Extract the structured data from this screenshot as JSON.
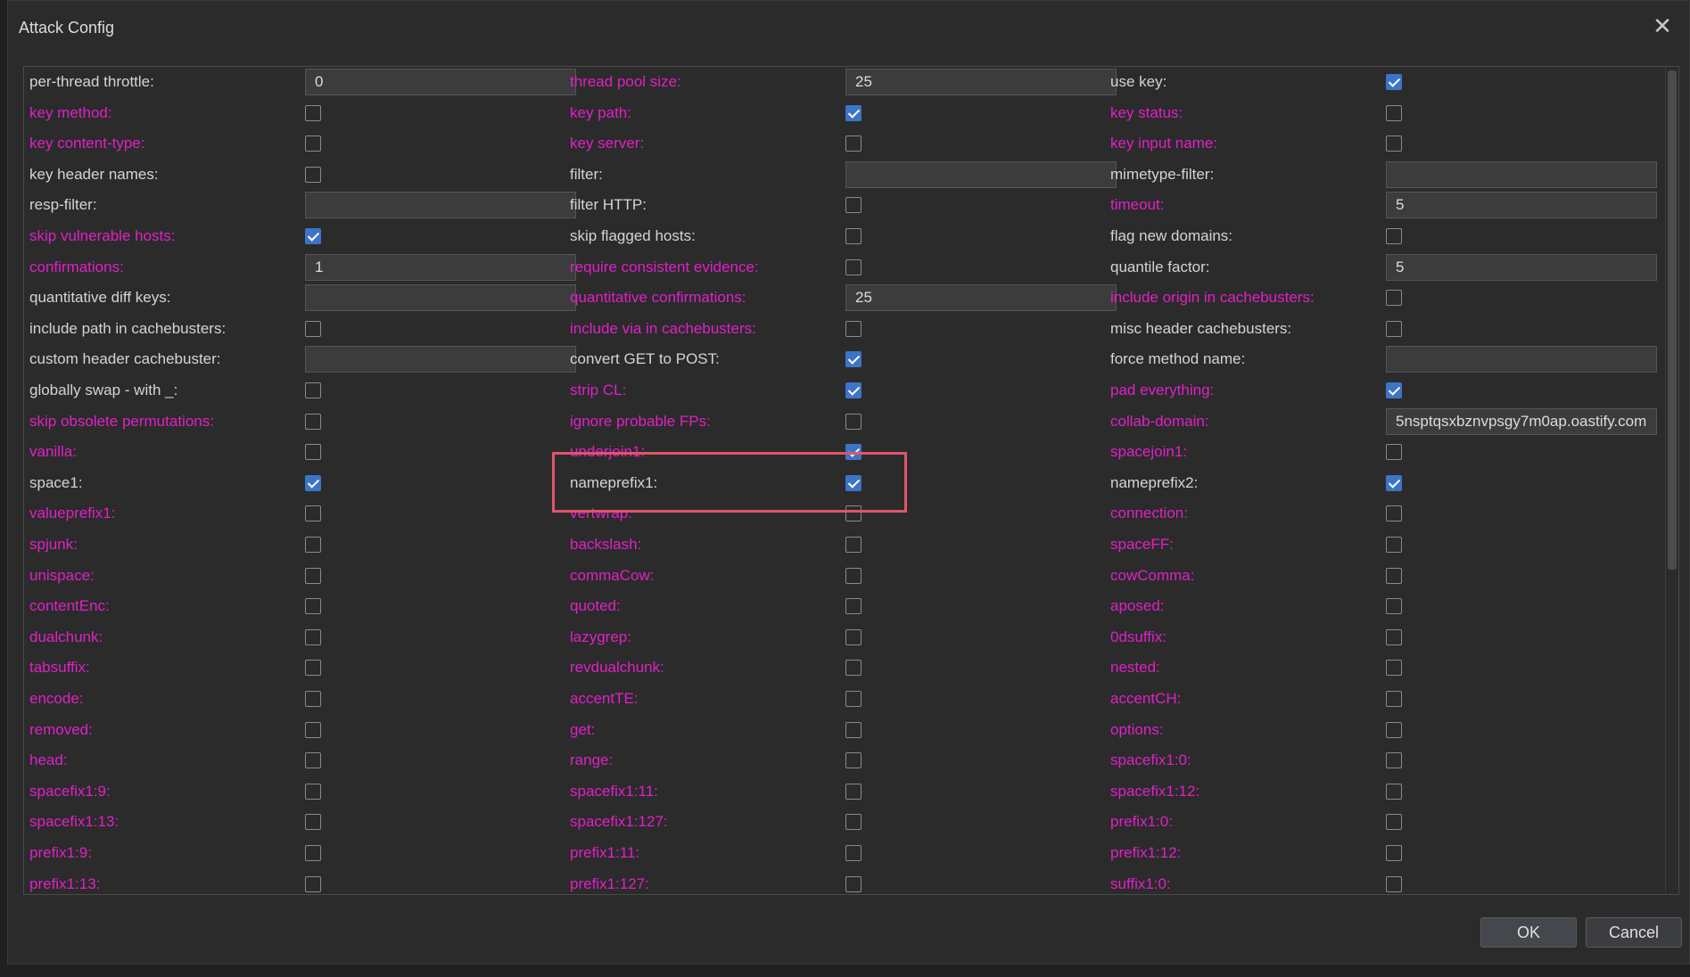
{
  "dialog": {
    "title": "Attack Config",
    "close_label": "✕",
    "ok_label": "OK",
    "cancel_label": "Cancel"
  },
  "colors": {
    "normal_label": "#d4d4d4",
    "special_label": "#e020c8",
    "checkbox_checked": "#3c74c8",
    "highlight": "#e0556a"
  },
  "rows": [
    [
      {
        "label": "per-thread throttle:",
        "special": false,
        "type": "text",
        "value": "0"
      },
      {
        "label": "thread pool size:",
        "special": true,
        "type": "text",
        "value": "25"
      },
      {
        "label": "use key:",
        "special": false,
        "type": "check",
        "checked": true
      }
    ],
    [
      {
        "label": "key method:",
        "special": true,
        "type": "check",
        "checked": false
      },
      {
        "label": "key path:",
        "special": true,
        "type": "check",
        "checked": true
      },
      {
        "label": "key status:",
        "special": true,
        "type": "check",
        "checked": false
      }
    ],
    [
      {
        "label": "key content-type:",
        "special": true,
        "type": "check",
        "checked": false
      },
      {
        "label": "key server:",
        "special": true,
        "type": "check",
        "checked": false
      },
      {
        "label": "key input name:",
        "special": true,
        "type": "check",
        "checked": false
      }
    ],
    [
      {
        "label": "key header names:",
        "special": false,
        "type": "check",
        "checked": false
      },
      {
        "label": "filter:",
        "special": false,
        "type": "text",
        "value": ""
      },
      {
        "label": "mimetype-filter:",
        "special": false,
        "type": "text",
        "value": ""
      }
    ],
    [
      {
        "label": "resp-filter:",
        "special": false,
        "type": "text",
        "value": ""
      },
      {
        "label": "filter HTTP:",
        "special": false,
        "type": "check",
        "checked": false
      },
      {
        "label": "timeout:",
        "special": true,
        "type": "text",
        "value": "5"
      }
    ],
    [
      {
        "label": "skip vulnerable hosts:",
        "special": true,
        "type": "check",
        "checked": true
      },
      {
        "label": "skip flagged hosts:",
        "special": false,
        "type": "check",
        "checked": false
      },
      {
        "label": "flag new domains:",
        "special": false,
        "type": "check",
        "checked": false
      }
    ],
    [
      {
        "label": "confirmations:",
        "special": true,
        "type": "text",
        "value": "1"
      },
      {
        "label": "require consistent evidence:",
        "special": true,
        "type": "check",
        "checked": false
      },
      {
        "label": "quantile factor:",
        "special": false,
        "type": "text",
        "value": "5"
      }
    ],
    [
      {
        "label": "quantitative diff keys:",
        "special": false,
        "type": "text",
        "value": ""
      },
      {
        "label": "quantitative confirmations:",
        "special": true,
        "type": "text",
        "value": "25"
      },
      {
        "label": "include origin in cachebusters:",
        "special": true,
        "type": "check",
        "checked": false
      }
    ],
    [
      {
        "label": "include path in cachebusters:",
        "special": false,
        "type": "check",
        "checked": false
      },
      {
        "label": "include via in cachebusters:",
        "special": true,
        "type": "check",
        "checked": false
      },
      {
        "label": "misc header cachebusters:",
        "special": false,
        "type": "check",
        "checked": false
      }
    ],
    [
      {
        "label": "custom header cachebuster:",
        "special": false,
        "type": "text",
        "value": ""
      },
      {
        "label": "convert GET to POST:",
        "special": false,
        "type": "check",
        "checked": true
      },
      {
        "label": "force method name:",
        "special": false,
        "type": "text",
        "value": ""
      }
    ],
    [
      {
        "label": "globally swap - with _:",
        "special": false,
        "type": "check",
        "checked": false
      },
      {
        "label": "strip CL:",
        "special": true,
        "type": "check",
        "checked": true
      },
      {
        "label": "pad everything:",
        "special": true,
        "type": "check",
        "checked": true
      }
    ],
    [
      {
        "label": "skip obsolete permutations:",
        "special": true,
        "type": "check",
        "checked": false
      },
      {
        "label": "ignore probable FPs:",
        "special": true,
        "type": "check",
        "checked": false
      },
      {
        "label": "collab-domain:",
        "special": true,
        "type": "text",
        "value": "5nsptqsxbznvpsgy7m0ap.oastify.com"
      }
    ],
    [
      {
        "label": "vanilla:",
        "special": true,
        "type": "check",
        "checked": false
      },
      {
        "label": "underjoin1:",
        "special": true,
        "type": "check",
        "checked": true
      },
      {
        "label": "spacejoin1:",
        "special": true,
        "type": "check",
        "checked": false
      }
    ],
    [
      {
        "label": "space1:",
        "special": false,
        "type": "check",
        "checked": true
      },
      {
        "label": "nameprefix1:",
        "special": false,
        "type": "check",
        "checked": true
      },
      {
        "label": "nameprefix2:",
        "special": false,
        "type": "check",
        "checked": true
      }
    ],
    [
      {
        "label": "valueprefix1:",
        "special": true,
        "type": "check",
        "checked": false
      },
      {
        "label": "vertwrap:",
        "special": true,
        "type": "check",
        "checked": false
      },
      {
        "label": "connection:",
        "special": true,
        "type": "check",
        "checked": false
      }
    ],
    [
      {
        "label": "spjunk:",
        "special": true,
        "type": "check",
        "checked": false
      },
      {
        "label": "backslash:",
        "special": true,
        "type": "check",
        "checked": false
      },
      {
        "label": "spaceFF:",
        "special": true,
        "type": "check",
        "checked": false
      }
    ],
    [
      {
        "label": "unispace:",
        "special": true,
        "type": "check",
        "checked": false
      },
      {
        "label": "commaCow:",
        "special": true,
        "type": "check",
        "checked": false
      },
      {
        "label": "cowComma:",
        "special": true,
        "type": "check",
        "checked": false
      }
    ],
    [
      {
        "label": "contentEnc:",
        "special": true,
        "type": "check",
        "checked": false
      },
      {
        "label": "quoted:",
        "special": true,
        "type": "check",
        "checked": false
      },
      {
        "label": "aposed:",
        "special": true,
        "type": "check",
        "checked": false
      }
    ],
    [
      {
        "label": "dualchunk:",
        "special": true,
        "type": "check",
        "checked": false
      },
      {
        "label": "lazygrep:",
        "special": true,
        "type": "check",
        "checked": false
      },
      {
        "label": "0dsuffix:",
        "special": true,
        "type": "check",
        "checked": false
      }
    ],
    [
      {
        "label": "tabsuffix:",
        "special": true,
        "type": "check",
        "checked": false
      },
      {
        "label": "revdualchunk:",
        "special": true,
        "type": "check",
        "checked": false
      },
      {
        "label": "nested:",
        "special": true,
        "type": "check",
        "checked": false
      }
    ],
    [
      {
        "label": "encode:",
        "special": true,
        "type": "check",
        "checked": false
      },
      {
        "label": "accentTE:",
        "special": true,
        "type": "check",
        "checked": false
      },
      {
        "label": "accentCH:",
        "special": true,
        "type": "check",
        "checked": false
      }
    ],
    [
      {
        "label": "removed:",
        "special": true,
        "type": "check",
        "checked": false
      },
      {
        "label": "get:",
        "special": true,
        "type": "check",
        "checked": false
      },
      {
        "label": "options:",
        "special": true,
        "type": "check",
        "checked": false
      }
    ],
    [
      {
        "label": "head:",
        "special": true,
        "type": "check",
        "checked": false
      },
      {
        "label": "range:",
        "special": true,
        "type": "check",
        "checked": false
      },
      {
        "label": "spacefix1:0:",
        "special": true,
        "type": "check",
        "checked": false
      }
    ],
    [
      {
        "label": "spacefix1:9:",
        "special": true,
        "type": "check",
        "checked": false
      },
      {
        "label": "spacefix1:11:",
        "special": true,
        "type": "check",
        "checked": false
      },
      {
        "label": "spacefix1:12:",
        "special": true,
        "type": "check",
        "checked": false
      }
    ],
    [
      {
        "label": "spacefix1:13:",
        "special": true,
        "type": "check",
        "checked": false
      },
      {
        "label": "spacefix1:127:",
        "special": true,
        "type": "check",
        "checked": false
      },
      {
        "label": "prefix1:0:",
        "special": true,
        "type": "check",
        "checked": false
      }
    ],
    [
      {
        "label": "prefix1:9:",
        "special": true,
        "type": "check",
        "checked": false
      },
      {
        "label": "prefix1:11:",
        "special": true,
        "type": "check",
        "checked": false
      },
      {
        "label": "prefix1:12:",
        "special": true,
        "type": "check",
        "checked": false
      }
    ],
    [
      {
        "label": "prefix1:13:",
        "special": true,
        "type": "check",
        "checked": false
      },
      {
        "label": "prefix1:127:",
        "special": true,
        "type": "check",
        "checked": false
      },
      {
        "label": "suffix1:0:",
        "special": true,
        "type": "check",
        "checked": false
      }
    ]
  ]
}
